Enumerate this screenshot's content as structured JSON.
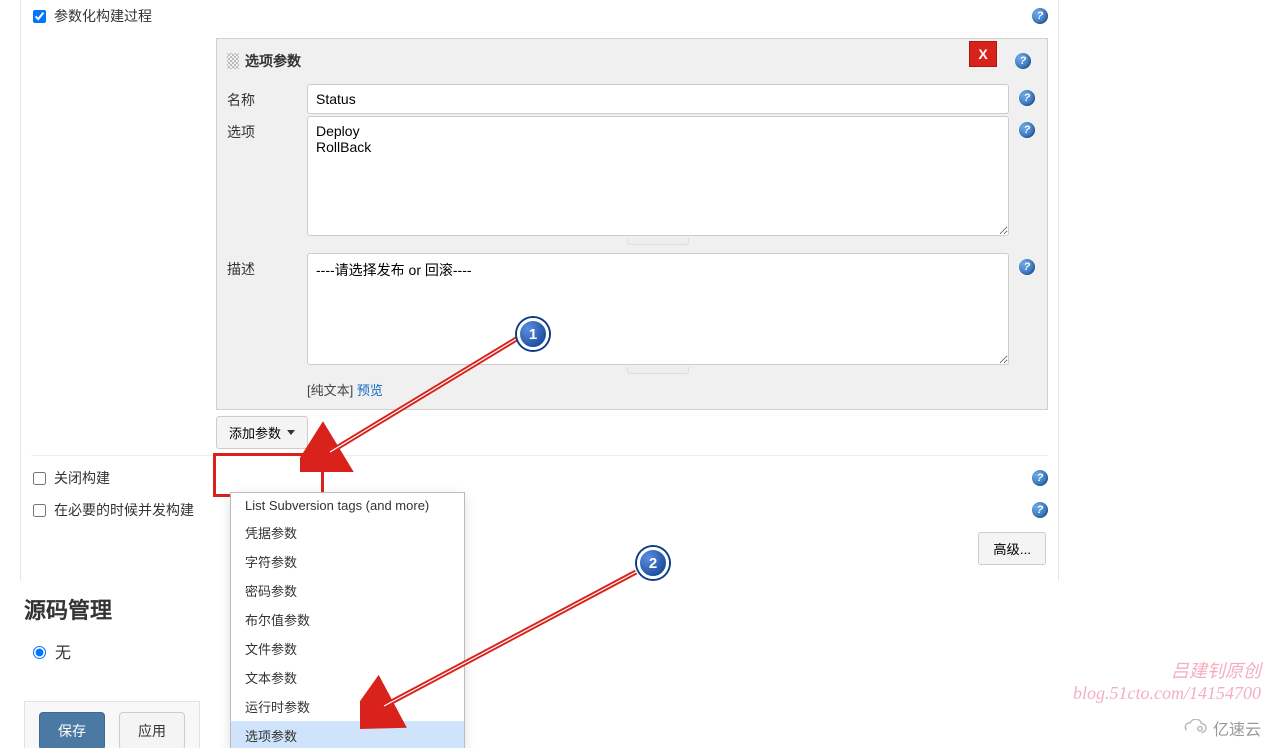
{
  "top_checkbox": {
    "label": "参数化构建过程",
    "checked": true
  },
  "param_box": {
    "title": "选项参数",
    "close": "X",
    "name_label": "名称",
    "name_value": "Status",
    "options_label": "选项",
    "options_value": "Deploy\nRollBack",
    "desc_label": "描述",
    "desc_value": "----请选择发布 or 回滚----",
    "desc_footer_plain": "[纯文本]",
    "desc_footer_link": "预览"
  },
  "add_param_label": "添加参数",
  "close_build": {
    "label": "关闭构建",
    "checked": false
  },
  "concurrent_build": {
    "label": "在必要的时候并发构建",
    "checked": false
  },
  "advanced_label": "高级...",
  "scm_title": "源码管理",
  "scm_none_label": "无",
  "dropdown_items": [
    "List Subversion tags (and more)",
    "凭据参数",
    "字符参数",
    "密码参数",
    "布尔值参数",
    "文件参数",
    "文本参数",
    "运行时参数",
    "选项参数"
  ],
  "buttons": {
    "save": "保存",
    "apply": "应用"
  },
  "watermark": {
    "line1": "吕建钊原创",
    "line2": "blog.51cto.com/14154700"
  },
  "wm_brand": "亿速云",
  "help_glyph": "?"
}
